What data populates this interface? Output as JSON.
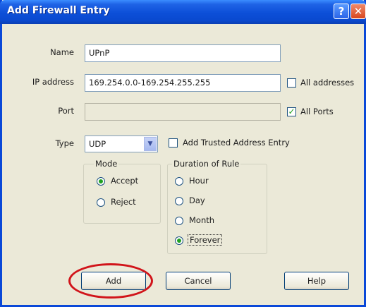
{
  "window": {
    "title": "Add Firewall Entry",
    "help_glyph": "?",
    "close_glyph": "✕"
  },
  "form": {
    "name_label": "Name",
    "name_value": "UPnP",
    "ip_label": "IP address",
    "ip_value": "169.254.0.0-169.254.255.255",
    "all_addresses_label": "All addresses",
    "all_addresses_checked": false,
    "port_label": "Port",
    "port_value": "",
    "all_ports_label": "All Ports",
    "all_ports_checked": true,
    "type_label": "Type",
    "type_value": "UDP",
    "trusted_label": "Add Trusted Address Entry",
    "trusted_checked": false
  },
  "mode": {
    "title": "Mode",
    "options": [
      {
        "label": "Accept",
        "selected": true
      },
      {
        "label": "Reject",
        "selected": false
      }
    ]
  },
  "duration": {
    "title": "Duration of Rule",
    "options": [
      {
        "label": "Hour",
        "selected": false
      },
      {
        "label": "Day",
        "selected": false
      },
      {
        "label": "Month",
        "selected": false
      },
      {
        "label": "Forever",
        "selected": true
      }
    ]
  },
  "buttons": {
    "add": "Add",
    "cancel": "Cancel",
    "help": "Help"
  },
  "colors": {
    "titlebar": "#0c4fd8",
    "dialog_bg": "#ebe9d8",
    "highlight": "#d1141a",
    "check": "#21a121"
  }
}
